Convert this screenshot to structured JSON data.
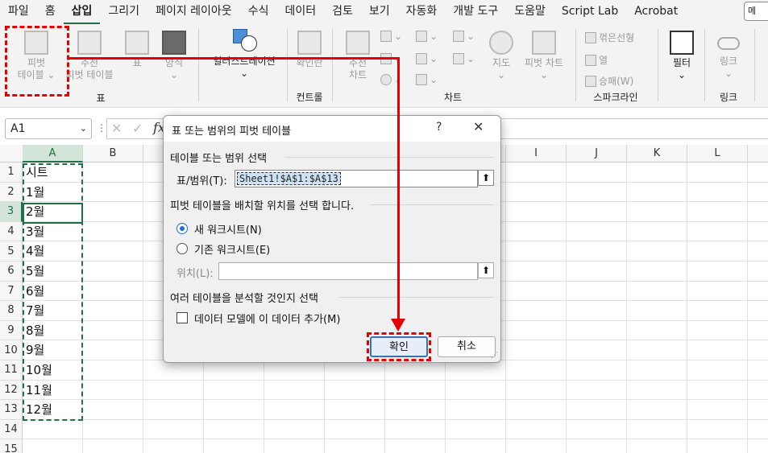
{
  "menu": {
    "items": [
      "파일",
      "홈",
      "삽입",
      "그리기",
      "페이지 레이아웃",
      "수식",
      "데이터",
      "검토",
      "보기",
      "자동화",
      "개발 도구",
      "도움말",
      "Script Lab",
      "Acrobat"
    ],
    "active_index": 2,
    "comment_button": "메"
  },
  "ribbon": {
    "pivot_table": [
      "피벗",
      "테이블"
    ],
    "recommended_pivot": [
      "추천",
      "피벗 테이블"
    ],
    "table": "표",
    "forms": "양식",
    "group_table": "표",
    "illustrations": "일러스트레이션",
    "checkbox": "확인란",
    "group_controls": "컨트롤",
    "recommended_chart": [
      "추천",
      "차트"
    ],
    "map": "지도",
    "pivot_chart": "피벗 차트",
    "group_charts": "차트",
    "spark_line": "꺾은선형",
    "spark_column": "열",
    "spark_winloss": "승패(W)",
    "group_sparklines": "스파크라인",
    "filter": "필터",
    "link": "링크",
    "group_links": "링크"
  },
  "formula_bar": {
    "name_box": "A1",
    "fx": "fx"
  },
  "grid": {
    "columns": [
      "A",
      "B",
      "C",
      "D",
      "E",
      "F",
      "G",
      "H",
      "I",
      "J",
      "K",
      "L"
    ],
    "rows": [
      "1",
      "2",
      "3",
      "4",
      "5",
      "6",
      "7",
      "8",
      "9",
      "10",
      "11",
      "12",
      "13",
      "14",
      "15"
    ],
    "cells_A": [
      "시트",
      "1월",
      "2월",
      "3월",
      "4월",
      "5월",
      "6월",
      "7월",
      "8월",
      "9월",
      "10월",
      "11월",
      "12월"
    ],
    "selected_column": "A",
    "selected_row": "3"
  },
  "dialog": {
    "title": "표 또는 범위의 피벗 테이블",
    "help": "?",
    "close": "✕",
    "section1": "테이블 또는 범위 선택",
    "range_label": "표/범위(T):",
    "range_value": "Sheet1!$A$1:$A$13",
    "section2": "피벗 테이블을 배치할 위치를 선택 합니다.",
    "new_sheet": "새 워크시트(N)",
    "existing_sheet": "기존 워크시트(E)",
    "location_label": "위치(L):",
    "location_value": "",
    "section3": "여러 테이블을 분석할 것인지 선택",
    "data_model": "데이터 모델에 이 데이터 추가(M)",
    "ok": "확인",
    "cancel": "취소"
  },
  "colors": {
    "accent_green": "#1e7145",
    "annotation_red": "#e60000",
    "radio_blue": "#1f6ed6"
  }
}
